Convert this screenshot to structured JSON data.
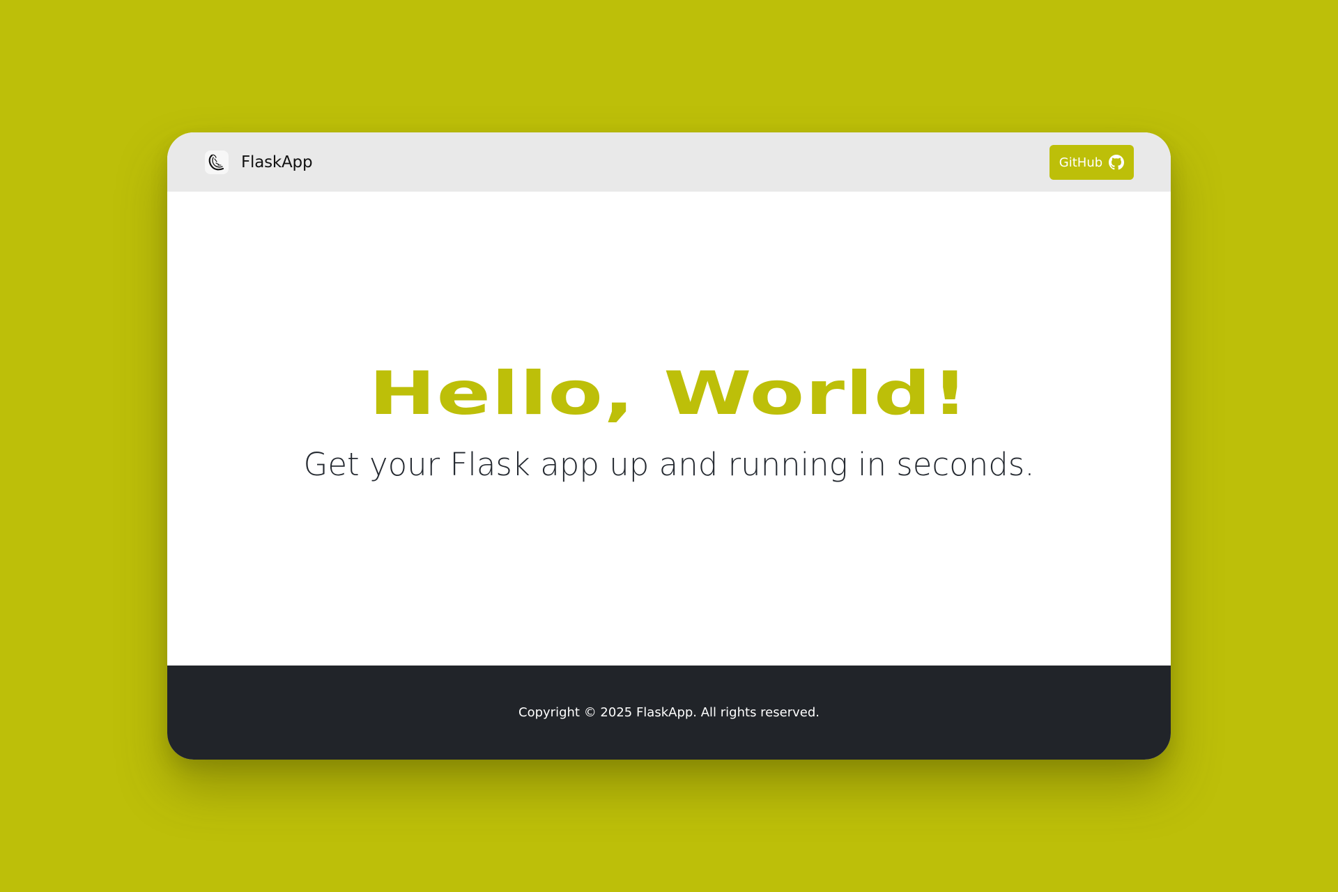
{
  "theme": {
    "accent": "#bdbf09",
    "navbar_background": "#e9e9e9",
    "footer_background": "#212429",
    "text_dark": "#252a31",
    "text_light": "#ffffff"
  },
  "navbar": {
    "brand_icon": "flask-logo-icon",
    "brand_name": "FlaskApp",
    "github_label": "GitHub",
    "github_icon": "github-icon"
  },
  "hero": {
    "title": "Hello, World!",
    "subtitle": "Get your Flask app up and running in seconds."
  },
  "footer": {
    "copyright": "Copyright © 2025 FlaskApp. All rights reserved."
  }
}
